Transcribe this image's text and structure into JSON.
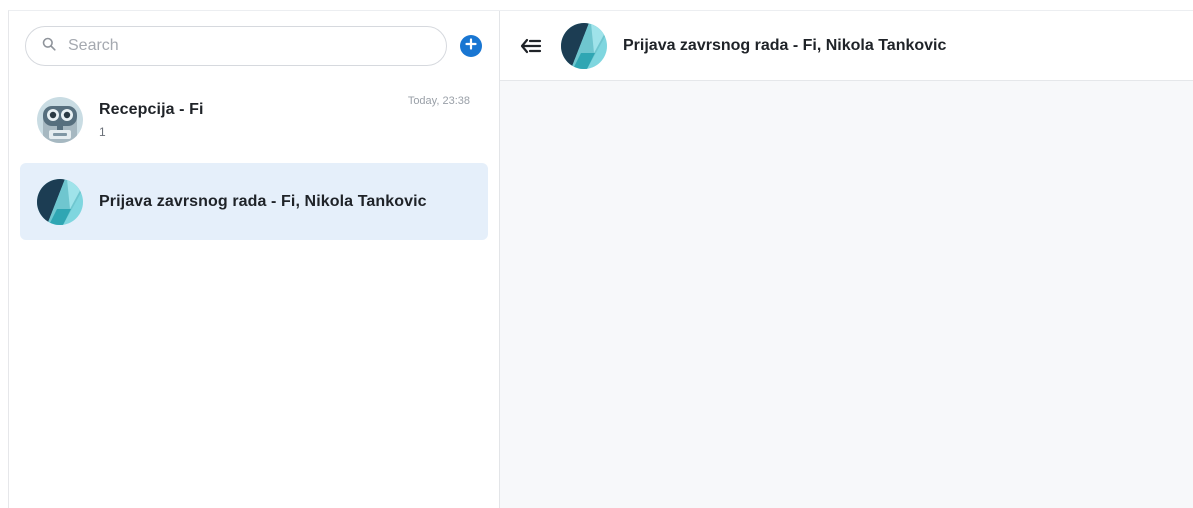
{
  "search": {
    "placeholder": "Search"
  },
  "icons": {
    "search": "search-icon",
    "add": "plus-circle-icon",
    "back": "arrow-left-menu-icon"
  },
  "colors": {
    "accent": "#1976d2",
    "selected_room_bg": "#e5effa",
    "main_bg": "#f7f8fa"
  },
  "rooms": [
    {
      "name": "Recepcija - Fi",
      "last_message": "1",
      "time": "Today, 23:38",
      "avatar": "robot-avatar"
    },
    {
      "name": "Prijava zavrsnog rada - Fi, Nikola Tankovic",
      "last_message": "",
      "time": "",
      "avatar": "teal-shapes-avatar"
    }
  ],
  "header": {
    "title": "Prijava zavrsnog rada - Fi, Nikola Tankovic"
  }
}
